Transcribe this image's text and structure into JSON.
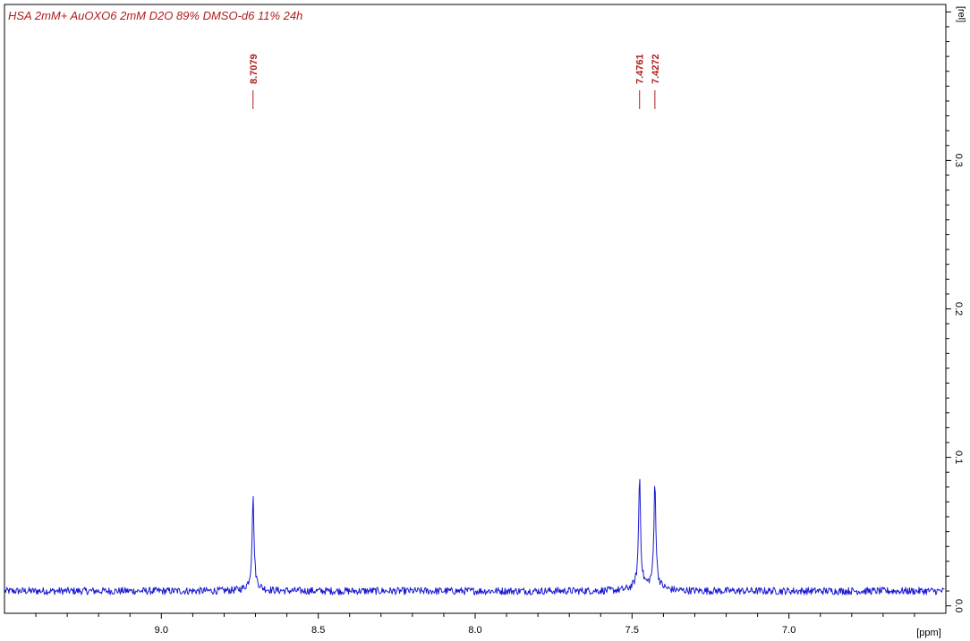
{
  "chart_data": {
    "type": "line",
    "title": "HSA 2mM+ AuOXO6 2mM D2O 89% DMSO-d6 11% 24h",
    "xlabel": "[ppm]",
    "ylabel": "[rel]",
    "xlim": [
      9.5,
      6.5
    ],
    "ylim": [
      -0.005,
      0.405
    ],
    "x_ticks": [
      9.0,
      8.5,
      8.0,
      7.5,
      7.0
    ],
    "x_tick_labels": [
      "9.0",
      "8.5",
      "8.0",
      "7.5",
      "7.0"
    ],
    "y_ticks": [
      0.0,
      0.1,
      0.2,
      0.3
    ],
    "y_tick_labels": [
      "0.0",
      "0.1",
      "0.2",
      "0.3"
    ],
    "baseline": 0.01,
    "noise_amplitude": 0.0025,
    "peaks": [
      {
        "label": "8.7079",
        "ppm": 8.7079,
        "height": 0.069
      },
      {
        "label": "7.4761",
        "ppm": 7.4761,
        "height": 0.083
      },
      {
        "label": "7.4272",
        "ppm": 7.4272,
        "height": 0.079
      }
    ],
    "colors": {
      "spectrum": "#1a1ad0",
      "annotation": "#b01c1c",
      "axis": "#000000"
    },
    "grid": false
  }
}
